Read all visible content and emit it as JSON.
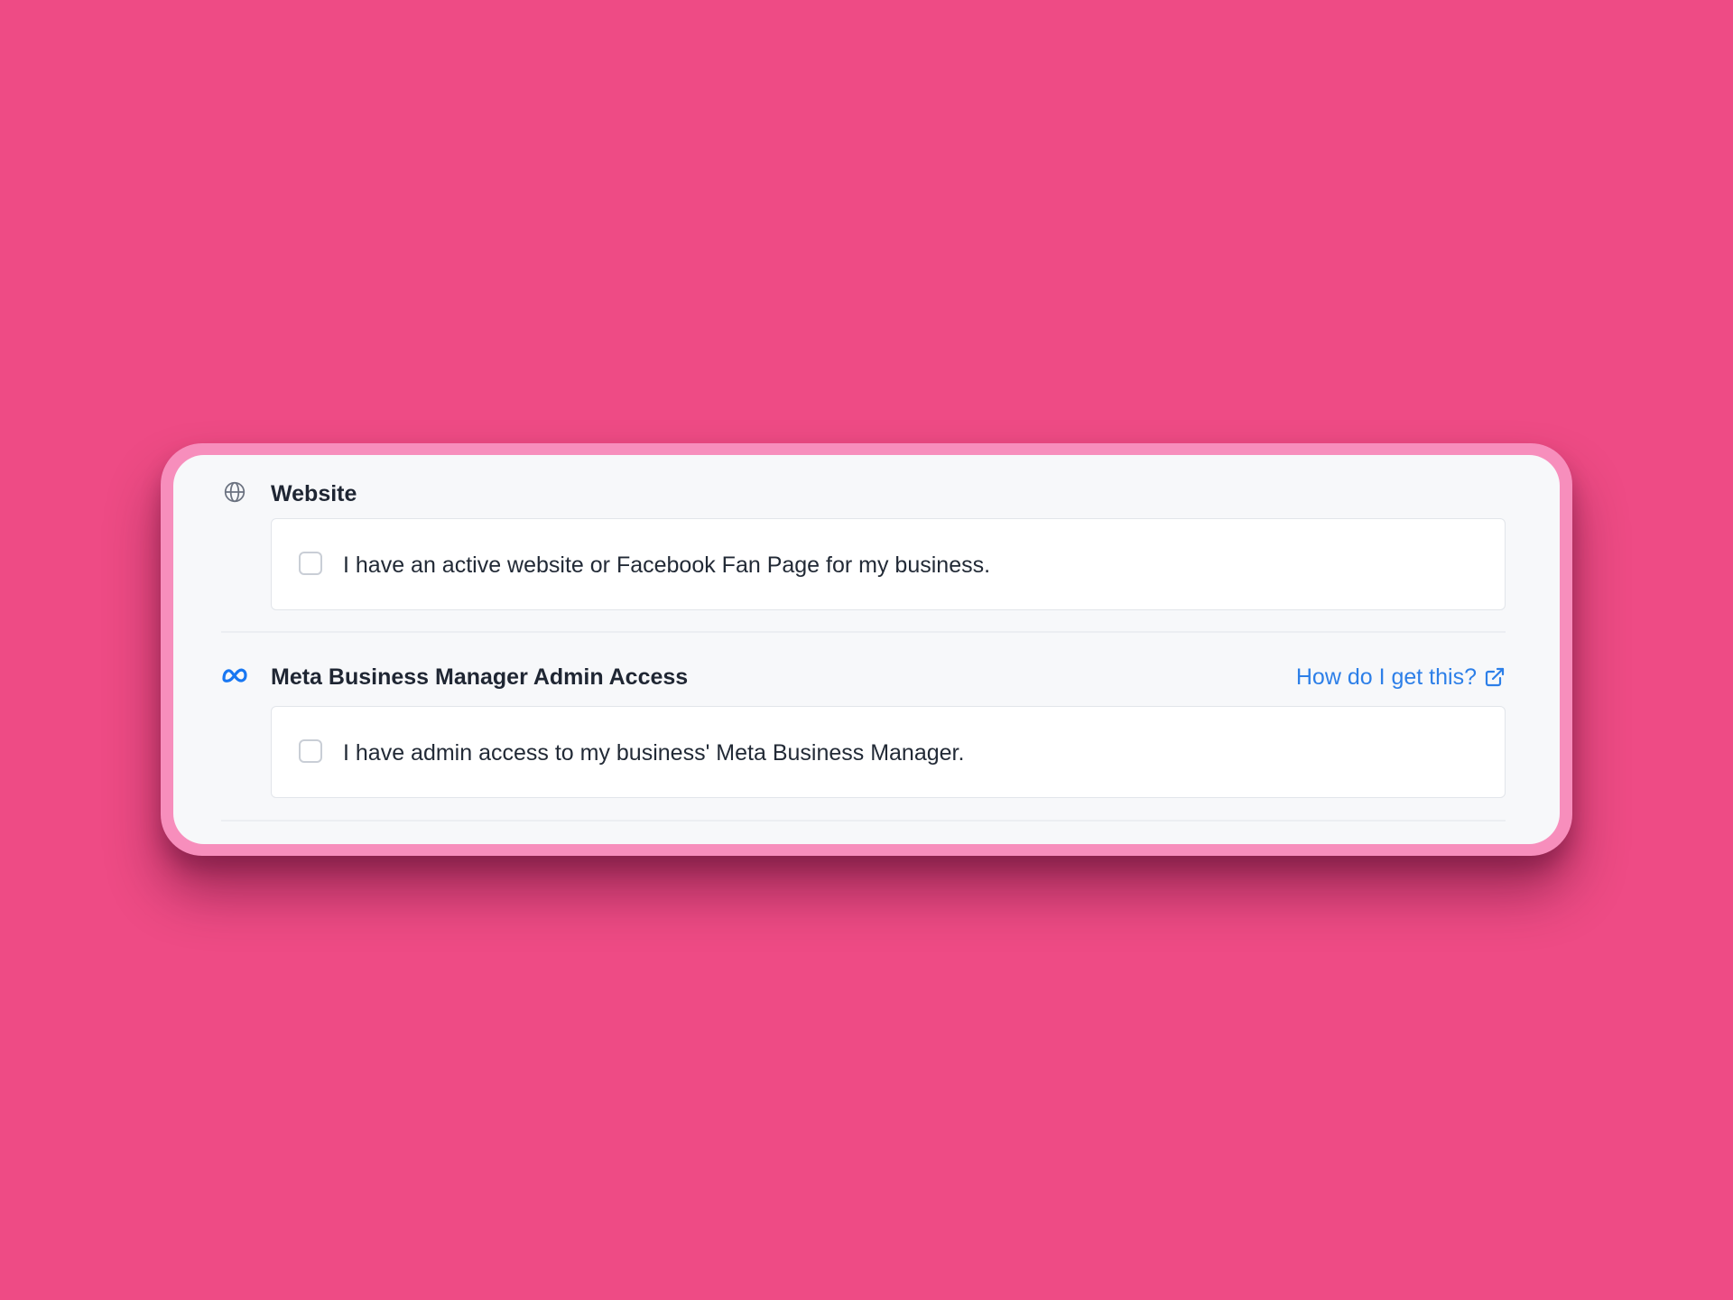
{
  "colors": {
    "background": "#ee4b85",
    "frame": "#f78ebc",
    "panel": "#f7f8fa",
    "link": "#2d7fe8",
    "meta_icon": "#1877f2",
    "globe_icon": "#6b7280",
    "text": "#1f2633"
  },
  "sections": [
    {
      "icon": "globe-icon",
      "title": "Website",
      "checkbox_checked": false,
      "option_label": "I have an active website or Facebook Fan Page for my business."
    },
    {
      "icon": "meta-logo-icon",
      "title": "Meta Business Manager Admin Access",
      "help_link": "How do I get this?",
      "help_link_icon": "external-link-icon",
      "checkbox_checked": false,
      "option_label": "I have admin access to my business' Meta Business Manager."
    }
  ]
}
